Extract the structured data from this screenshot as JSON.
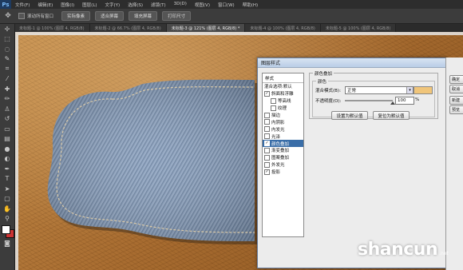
{
  "app": {
    "logo": "Ps"
  },
  "menubar": {
    "items": [
      "文件(F)",
      "编辑(E)",
      "图像(I)",
      "图层(L)",
      "文字(Y)",
      "选择(S)",
      "滤镜(T)",
      "3D(D)",
      "视图(V)",
      "窗口(W)",
      "帮助(H)"
    ]
  },
  "options": {
    "scroll_all_label": "滚动所有窗口",
    "buttons": [
      "实际像素",
      "适合屏幕",
      "填充屏幕",
      "打印尺寸"
    ]
  },
  "tabs": [
    {
      "label": "未标题-1 @ 100% (图层 4, RGB/8)",
      "active": false
    },
    {
      "label": "未标题-2 @ 66.7% (图层 4, RGB/8)",
      "active": false
    },
    {
      "label": "未标题-3 @ 121% (图层 4, RGB/8) *",
      "active": true
    },
    {
      "label": "未标题-4 @ 100% (图层 4, RGB/8)",
      "active": false
    },
    {
      "label": "未标题-5 @ 100% (图层 4, RGB/8)",
      "active": false
    }
  ],
  "dialog": {
    "title": "图层样式",
    "styles_header": "样式",
    "style_items": [
      {
        "label": "混合选项:默认",
        "checkbox": false,
        "checked": false,
        "indent": false,
        "selected": false
      },
      {
        "label": "斜面和浮雕",
        "checkbox": true,
        "checked": true,
        "indent": false,
        "selected": false
      },
      {
        "label": "等高线",
        "checkbox": true,
        "checked": false,
        "indent": true,
        "selected": false
      },
      {
        "label": "纹理",
        "checkbox": true,
        "checked": false,
        "indent": true,
        "selected": false
      },
      {
        "label": "描边",
        "checkbox": true,
        "checked": false,
        "indent": false,
        "selected": false
      },
      {
        "label": "内阴影",
        "checkbox": true,
        "checked": false,
        "indent": false,
        "selected": false
      },
      {
        "label": "内发光",
        "checkbox": true,
        "checked": false,
        "indent": false,
        "selected": false
      },
      {
        "label": "光泽",
        "checkbox": true,
        "checked": false,
        "indent": false,
        "selected": false
      },
      {
        "label": "颜色叠加",
        "checkbox": true,
        "checked": true,
        "indent": false,
        "selected": true
      },
      {
        "label": "渐变叠加",
        "checkbox": true,
        "checked": false,
        "indent": false,
        "selected": false
      },
      {
        "label": "图案叠加",
        "checkbox": true,
        "checked": false,
        "indent": false,
        "selected": false
      },
      {
        "label": "外发光",
        "checkbox": true,
        "checked": false,
        "indent": false,
        "selected": false
      },
      {
        "label": "投影",
        "checkbox": true,
        "checked": true,
        "indent": false,
        "selected": false
      }
    ],
    "section_title": "颜色叠加",
    "subsection_title": "颜色",
    "blend_mode_label": "混合模式(B):",
    "blend_mode_value": "正常",
    "overlay_color": "#f0c57a",
    "opacity_label": "不透明度(O):",
    "opacity_value": "100",
    "opacity_unit": "%",
    "opacity_level": 1.0,
    "set_default_button": "设置为默认值",
    "reset_default_button": "复位为默认值"
  },
  "right_panel": {
    "buttons": [
      "确定",
      "取消",
      "新建",
      "预览"
    ]
  },
  "watermark": {
    "text": "shancun",
    "sub": ".net"
  }
}
